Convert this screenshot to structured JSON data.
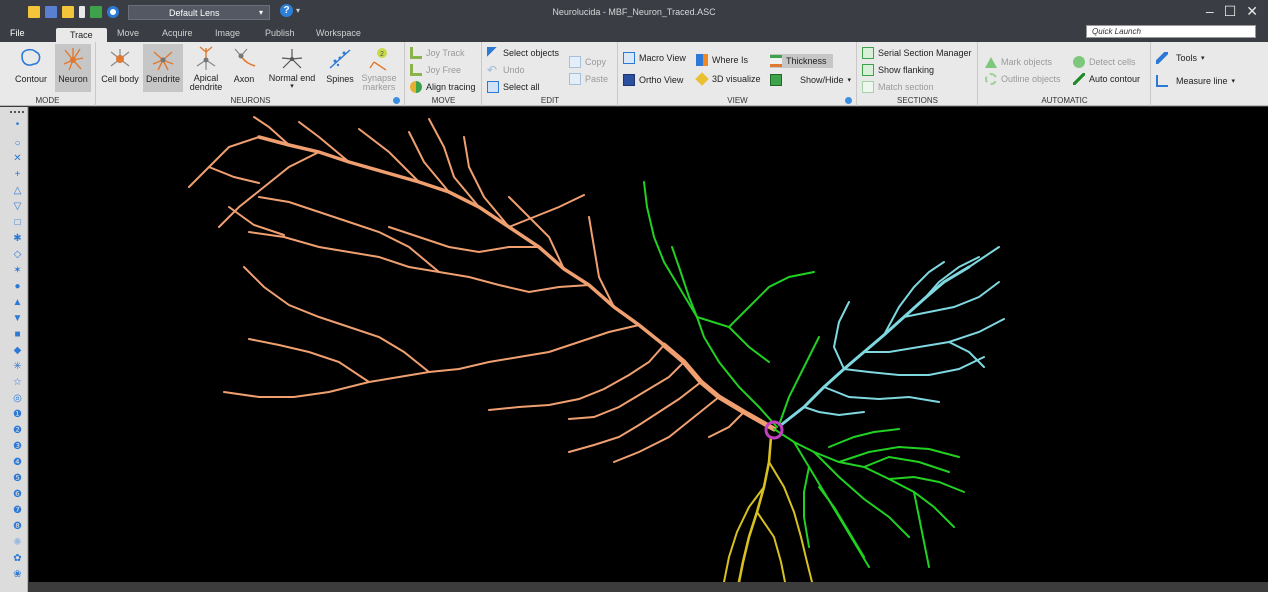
{
  "app": {
    "title": "Neurolucida - MBF_Neuron_Traced.ASC",
    "lens": "Default Lens",
    "quick_launch": "Quick Launch",
    "help_glyph": "?",
    "dropdown_arrow": "▾",
    "minimize": "–",
    "maximize": "☐",
    "close": "✕"
  },
  "tabs": [
    "File",
    "Trace",
    "Move",
    "Acquire",
    "Image",
    "Publish",
    "Workspace"
  ],
  "active_tab": "Trace",
  "ribbon": {
    "mode": {
      "label": "MODE",
      "contour": "Contour",
      "neuron": "Neuron"
    },
    "neurons": {
      "label": "NEURONS",
      "cell_body": "Cell body",
      "dendrite": "Dendrite",
      "apical_line1": "Apical",
      "apical_line2": "dendrite",
      "axon": "Axon",
      "normal_end": "Normal end",
      "spines": "Spines",
      "synapse_line1": "Synapse",
      "synapse_line2": "markers"
    },
    "move": {
      "label": "MOVE",
      "joy_track": "Joy Track",
      "joy_free": "Joy Free",
      "align_tracing": "Align tracing"
    },
    "edit": {
      "label": "EDIT",
      "select_objects": "Select objects",
      "undo": "Undo",
      "select_all": "Select all",
      "copy": "Copy",
      "paste": "Paste"
    },
    "view": {
      "label": "VIEW",
      "macro_view": "Macro View",
      "ortho_view": "Ortho View",
      "where_is": "Where Is",
      "visualize_3d": "3D visualize",
      "thickness": "Thickness",
      "show_hide": "Show/Hide"
    },
    "sections": {
      "label": "SECTIONS",
      "serial_section_manager": "Serial Section Manager",
      "show_flanking": "Show flanking",
      "match_section": "Match section"
    },
    "automatic": {
      "label": "AUTOMATIC",
      "mark_objects": "Mark objects",
      "outline_objects": "Outline objects",
      "detect_cells": "Detect cells",
      "auto_contour": "Auto contour"
    },
    "tools": {
      "tools": "Tools",
      "measure_line": "Measure line"
    }
  },
  "colors": {
    "accent": "#2d7ad6",
    "dendrite_orange": "#f0a070",
    "dendrite_cyan": "#7fd8e0",
    "dendrite_green": "#22d022",
    "axon_yellow": "#d8c020",
    "soma_magenta": "#c040c0",
    "canvas_bg": "#000000"
  }
}
